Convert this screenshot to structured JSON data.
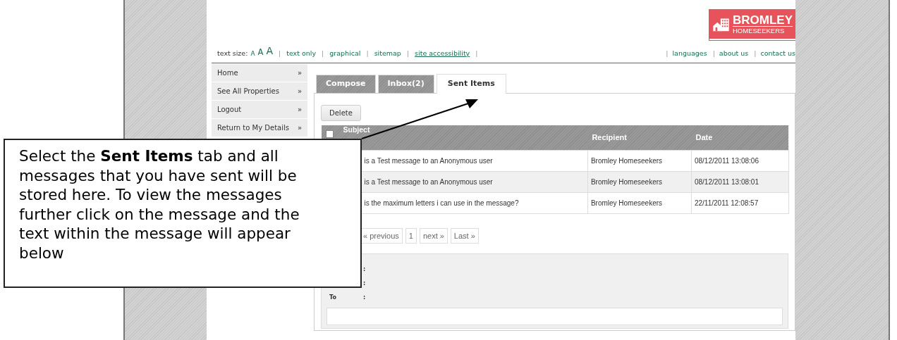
{
  "logo": {
    "line_1": "BROMLEY",
    "line_2": "HOMESEEKERS"
  },
  "text_size": {
    "label": "text size:",
    "options": [
      "A",
      "A",
      "A"
    ],
    "separator": "|"
  },
  "top_links": [
    {
      "label": "text only",
      "underlined": false,
      "separator": "|"
    },
    {
      "label": "graphical",
      "underlined": false,
      "separator": "|"
    },
    {
      "label": "sitemap",
      "underlined": false,
      "separator": "|"
    },
    {
      "label": "site accessibility",
      "underlined": true,
      "separator": "|"
    }
  ],
  "right_links": [
    {
      "separator": "|",
      "label": "languages"
    },
    {
      "separator": "|",
      "label": "about us"
    },
    {
      "separator": "|",
      "label": "contact us"
    }
  ],
  "sidebar": {
    "items": [
      {
        "label": "Home",
        "arrow": "»"
      },
      {
        "label": "See All Properties",
        "arrow": "»"
      },
      {
        "label": "Logout",
        "arrow": "»"
      },
      {
        "label": "Return to My Details",
        "arrow": "»"
      }
    ]
  },
  "tabs": [
    {
      "label": "Compose",
      "selected": false
    },
    {
      "label": "Inbox(2)",
      "selected": false
    },
    {
      "label": "Sent Items",
      "selected": true
    }
  ],
  "delete_button": "Delete",
  "table": {
    "columns": [
      "Subject",
      "Recipient",
      "Date"
    ],
    "select_all_checked": false,
    "rows": [
      {
        "subject": "is a Test message to an Anonymous user",
        "recipient": "Bromley Homeseekers",
        "date": "08/12/2011 13:08:06"
      },
      {
        "subject": "is a Test message to an Anonymous user",
        "recipient": "Bromley Homeseekers",
        "date": "08/12/2011 13:08:01"
      },
      {
        "subject": "is the maximum letters i can use in the message?",
        "recipient": "Bromley Homeseekers",
        "date": "22/11/2011 12:08:57"
      }
    ]
  },
  "pagination": [
    "« previous",
    "1",
    "next »",
    "Last »"
  ],
  "detail": {
    "fields": [
      {
        "separator": ":"
      },
      {
        "separator": ":"
      },
      {
        "label": "To",
        "separator": ":"
      }
    ]
  },
  "callout": {
    "text": "Select the **Sent Items** tab and all messages that you have sent will be stored here. To view the messages further click on the message and the text within the message will appear below"
  }
}
